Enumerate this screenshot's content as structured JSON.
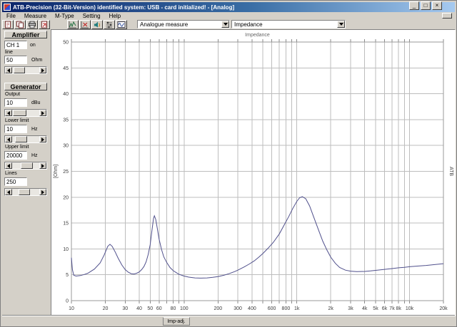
{
  "window": {
    "title": "ATB-Precision  (32-Bit-Version)  identified system: USB - card  initialized! - [Analog]",
    "controls": {
      "minimize": "_",
      "maximize": "□",
      "close": "×"
    }
  },
  "menu": {
    "items": [
      "File",
      "Measure",
      "M-Type",
      "Setting",
      "Help"
    ]
  },
  "toolbar": {
    "file_buttons": [
      "new-document-icon",
      "copy-icon",
      "printer-icon",
      "export-icon"
    ],
    "measure_buttons": [
      "measure-curve-icon",
      "measure-cancel-icon",
      "speaker-measure-icon",
      "levels-icon",
      "scope-icon"
    ],
    "combo1": {
      "value": "Analogue measure"
    },
    "combo2": {
      "value": "Impedance"
    }
  },
  "sidebar": {
    "amplifier": {
      "title": "Amplifier",
      "channel_value": "CH 1",
      "channel_suffix": "on",
      "sub_label": "line",
      "field": {
        "value": "50",
        "unit": "Ohm",
        "thumb_pos": 0.1,
        "thumb_size": 0.42
      }
    },
    "generator": {
      "title": "Generator",
      "fields": [
        {
          "label": "Output",
          "value": "10",
          "unit": "dBu",
          "thumb_pos": 0.05,
          "thumb_size": 0.5
        },
        {
          "label": "Lower limit",
          "value": "10",
          "unit": "Hz",
          "thumb_pos": 0.2,
          "thumb_size": 0.45
        },
        {
          "label": "Upper limit",
          "value": "20000",
          "unit": "Hz",
          "thumb_pos": 0.55,
          "thumb_size": 0.45
        },
        {
          "label": "Lines",
          "value": "250",
          "unit": "",
          "thumb_pos": 0.4,
          "thumb_size": 0.42
        }
      ]
    }
  },
  "chart_data": {
    "type": "line",
    "title": "Impedance",
    "ylabel": "[Ohm]",
    "right_label": "ATB",
    "x_scale": "log",
    "grid": true,
    "xlim": [
      10,
      20000
    ],
    "ylim": [
      0,
      50
    ],
    "y_ticks": [
      0,
      5,
      10,
      15,
      20,
      25,
      30,
      35,
      40,
      45,
      50
    ],
    "x_gridlines": [
      10,
      20,
      30,
      40,
      50,
      60,
      70,
      80,
      90,
      100,
      200,
      300,
      400,
      500,
      600,
      700,
      800,
      900,
      1000,
      2000,
      3000,
      4000,
      5000,
      6000,
      7000,
      8000,
      9000,
      10000,
      20000
    ],
    "x_tick_labels": [
      {
        "value": 10,
        "label": "10"
      },
      {
        "value": 20,
        "label": "20"
      },
      {
        "value": 30,
        "label": "30"
      },
      {
        "value": 40,
        "label": "40"
      },
      {
        "value": 50,
        "label": "50"
      },
      {
        "value": 60,
        "label": "60"
      },
      {
        "value": 80,
        "label": "80"
      },
      {
        "value": 100,
        "label": "100"
      },
      {
        "value": 200,
        "label": "200"
      },
      {
        "value": 300,
        "label": "300"
      },
      {
        "value": 400,
        "label": "400"
      },
      {
        "value": 600,
        "label": "600"
      },
      {
        "value": 800,
        "label": "800"
      },
      {
        "value": 1000,
        "label": "1k"
      },
      {
        "value": 2000,
        "label": "2k"
      },
      {
        "value": 3000,
        "label": "3k"
      },
      {
        "value": 4000,
        "label": "4k"
      },
      {
        "value": 5000,
        "label": "5k"
      },
      {
        "value": 6000,
        "label": "6k"
      },
      {
        "value": 7000,
        "label": "7k"
      },
      {
        "value": 8000,
        "label": "8k"
      },
      {
        "value": 10000,
        "label": "10k"
      },
      {
        "value": 20000,
        "label": "20k"
      }
    ],
    "series": [
      {
        "name": "impedance-curve",
        "color": "#50508c",
        "points": [
          [
            10,
            8.3
          ],
          [
            10.2,
            6.0
          ],
          [
            10.5,
            4.9
          ],
          [
            11,
            4.75
          ],
          [
            12,
            4.85
          ],
          [
            13,
            5.05
          ],
          [
            14,
            5.3
          ],
          [
            16,
            6.1
          ],
          [
            18,
            7.3
          ],
          [
            19.5,
            8.8
          ],
          [
            21,
            10.5
          ],
          [
            22,
            10.9
          ],
          [
            23,
            10.5
          ],
          [
            24.5,
            9.4
          ],
          [
            26,
            8.2
          ],
          [
            28,
            6.9
          ],
          [
            30,
            6.0
          ],
          [
            32,
            5.5
          ],
          [
            34,
            5.2
          ],
          [
            36,
            5.15
          ],
          [
            38,
            5.3
          ],
          [
            40,
            5.55
          ],
          [
            42,
            6.0
          ],
          [
            44,
            6.6
          ],
          [
            46,
            7.5
          ],
          [
            48,
            8.9
          ],
          [
            50,
            10.8
          ],
          [
            52,
            13.8
          ],
          [
            53.5,
            15.9
          ],
          [
            54.5,
            16.4
          ],
          [
            56,
            15.7
          ],
          [
            58,
            13.8
          ],
          [
            60,
            11.9
          ],
          [
            63,
            9.9
          ],
          [
            66,
            8.5
          ],
          [
            70,
            7.4
          ],
          [
            75,
            6.4
          ],
          [
            80,
            5.8
          ],
          [
            90,
            5.1
          ],
          [
            100,
            4.75
          ],
          [
            110,
            4.55
          ],
          [
            125,
            4.4
          ],
          [
            140,
            4.35
          ],
          [
            160,
            4.4
          ],
          [
            180,
            4.5
          ],
          [
            200,
            4.65
          ],
          [
            225,
            4.9
          ],
          [
            250,
            5.2
          ],
          [
            280,
            5.6
          ],
          [
            300,
            5.9
          ],
          [
            340,
            6.5
          ],
          [
            380,
            7.1
          ],
          [
            420,
            7.7
          ],
          [
            460,
            8.4
          ],
          [
            500,
            9.1
          ],
          [
            560,
            10.2
          ],
          [
            620,
            11.3
          ],
          [
            700,
            12.9
          ],
          [
            780,
            14.8
          ],
          [
            850,
            16.3
          ],
          [
            920,
            17.8
          ],
          [
            1000,
            19.2
          ],
          [
            1060,
            19.9
          ],
          [
            1120,
            20.1
          ],
          [
            1200,
            19.7
          ],
          [
            1300,
            18.3
          ],
          [
            1400,
            16.4
          ],
          [
            1550,
            13.8
          ],
          [
            1700,
            11.5
          ],
          [
            1850,
            9.8
          ],
          [
            2000,
            8.4
          ],
          [
            2200,
            7.2
          ],
          [
            2400,
            6.4
          ],
          [
            2700,
            5.9
          ],
          [
            3000,
            5.7
          ],
          [
            3400,
            5.6
          ],
          [
            4000,
            5.65
          ],
          [
            4500,
            5.75
          ],
          [
            5000,
            5.85
          ],
          [
            6000,
            6.05
          ],
          [
            7000,
            6.2
          ],
          [
            8000,
            6.35
          ],
          [
            9000,
            6.45
          ],
          [
            10000,
            6.55
          ],
          [
            12000,
            6.7
          ],
          [
            14000,
            6.8
          ],
          [
            17000,
            7.0
          ],
          [
            20000,
            7.15
          ]
        ]
      }
    ]
  },
  "status_bar": {
    "tab": "Imp-adj."
  }
}
